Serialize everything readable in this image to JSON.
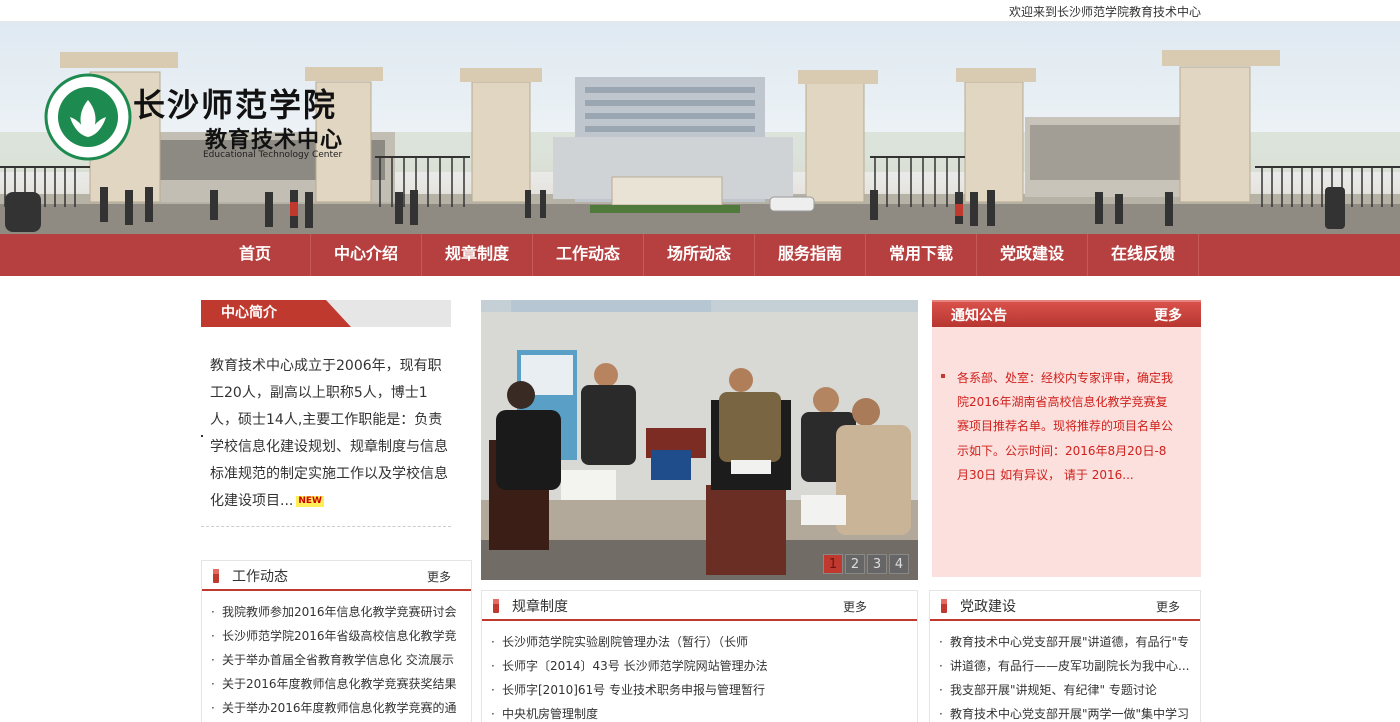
{
  "topbar": {
    "welcome": "欢迎来到长沙师范学院教育技术中心"
  },
  "banner": {
    "school_name": "长沙师范学院",
    "center_name": "教育技术中心",
    "center_name_en": "Educational Technology Center",
    "gate_sign": "长沙师范学院"
  },
  "nav": {
    "items": [
      "首页",
      "中心介绍",
      "规章制度",
      "工作动态",
      "场所动态",
      "服务指南",
      "常用下载",
      "党政建设",
      "在线反馈"
    ]
  },
  "intro": {
    "title": "中心简介",
    "text": "教育技术中心成立于2006年，现有职工20人，副高以上职称5人，博士1人，硕士14人,主要工作职能是：负责学校信息化建设规划、规章制度与信息标准规范的制定实施工作以及学校信息化建设项目...",
    "badge": "NEW"
  },
  "slideshow": {
    "pages": [
      "1",
      "2",
      "3",
      "4"
    ],
    "active": 1
  },
  "notice": {
    "title": "通知公告",
    "more": "更多",
    "text": "各系部、处室：经校内专家评审，确定我院2016年湖南省高校信息化教学竞赛复赛项目推荐名单。现将推荐的项目名单公示如下。公示时间：2016年8月20日-8月30日 如有异议， 请于 2016..."
  },
  "work_news": {
    "title": "工作动态",
    "more": "更多",
    "items": [
      "我院教师参加2016年信息化教学竞赛研讨会",
      "长沙师范学院2016年省级高校信息化教学竞",
      "关于举办首届全省教育教学信息化 交流展示",
      "关于2016年度教师信息化教学竞赛获奖结果",
      "关于举办2016年度教师信息化教学竞赛的通"
    ]
  },
  "rules": {
    "title": "规章制度",
    "more": "更多",
    "items": [
      "长沙师范学院实验剧院管理办法（暂行）（长师",
      "长师字〔2014〕43号 长沙师范学院网站管理办法",
      "长师字[2010]61号 专业技术职务申报与管理暂行",
      "中央机房管理制度"
    ]
  },
  "party": {
    "title": "党政建设",
    "more": "更多",
    "items": [
      "教育技术中心党支部开展\"讲道德，有品行\"专",
      "讲道德，有品行——皮军功副院长为我中心...",
      "我支部开展\"讲规矩、有纪律\" 专题讨论",
      "教育技术中心党支部开展\"两学一做\"集中学习"
    ]
  }
}
